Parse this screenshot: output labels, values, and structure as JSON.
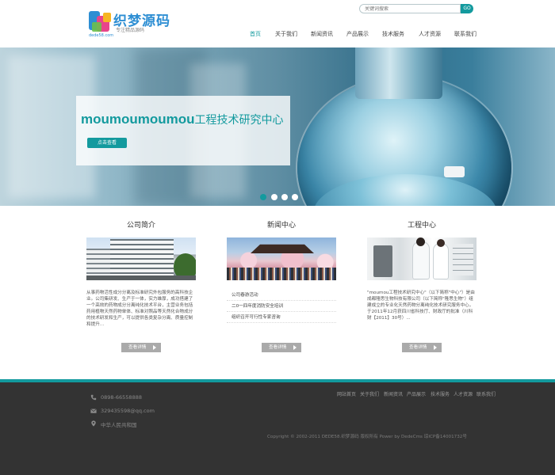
{
  "header": {
    "logo_cn": "织梦源码",
    "logo_en": "dede58.com",
    "logo_tagline": "专注精品源码",
    "search_placeholder": "关键词搜索",
    "search_button": "GO"
  },
  "nav": {
    "items": [
      "首页",
      "关于我们",
      "新闻资讯",
      "产品展示",
      "技术服务",
      "人才资源",
      "联系我们"
    ],
    "active_index": 0
  },
  "banner": {
    "caption_main": "moumoumoumou",
    "caption_rest": "工程技术研究中心",
    "button_label": "点击查看",
    "slide_count": 4,
    "active_slide": 0
  },
  "columns": {
    "about": {
      "title": "公司简介",
      "text": "从事药物活性成分分离及标准研究外包服务的高科技企业。公司集研发、生产于一体，实力雄厚，成功搭建了一个高效的药物成分分离纯化技术平台，主营业务包括药用植物天然药物单体、标准对照品等天然化合物成分的技术研发和生产，可以提供各类复杂分离、质量控制和提升...",
      "more_label": "查看详情"
    },
    "news": {
      "title": "新闻中心",
      "items": [
        "公司春游活动",
        "二0一四年度消防安全培训",
        "组织召开可行性专家咨询"
      ],
      "more_label": "查看详情"
    },
    "engineering": {
      "title": "工程中心",
      "text": "\"moumou工程技术研究中心\"（以下简称\"中心\"）是由成都隆思生物科技有限公司（以下简称\"隆思生物\"）组建成立的专业化天然药物分离纯化技术研究服务中心，于2011年12月获四川省科技厅、财政厅的批准（川科财【2011】30号）...",
      "more_label": "查看详情"
    }
  },
  "footer": {
    "phone": "0898-66558888",
    "email": "329435598@qq.com",
    "address": "中华人民共和国",
    "nav": [
      "网站首页",
      "关于我们",
      "新闻资讯",
      "产品展示",
      "技术服务",
      "人才资源",
      "联系我们"
    ],
    "copyright": "Copyright © 2002-2011 DEDE58.织梦源码 版权所有 Power by DedeCms   琼ICP备14001732号"
  },
  "colors": {
    "accent": "#139a9e",
    "footer_bg": "#333333"
  }
}
